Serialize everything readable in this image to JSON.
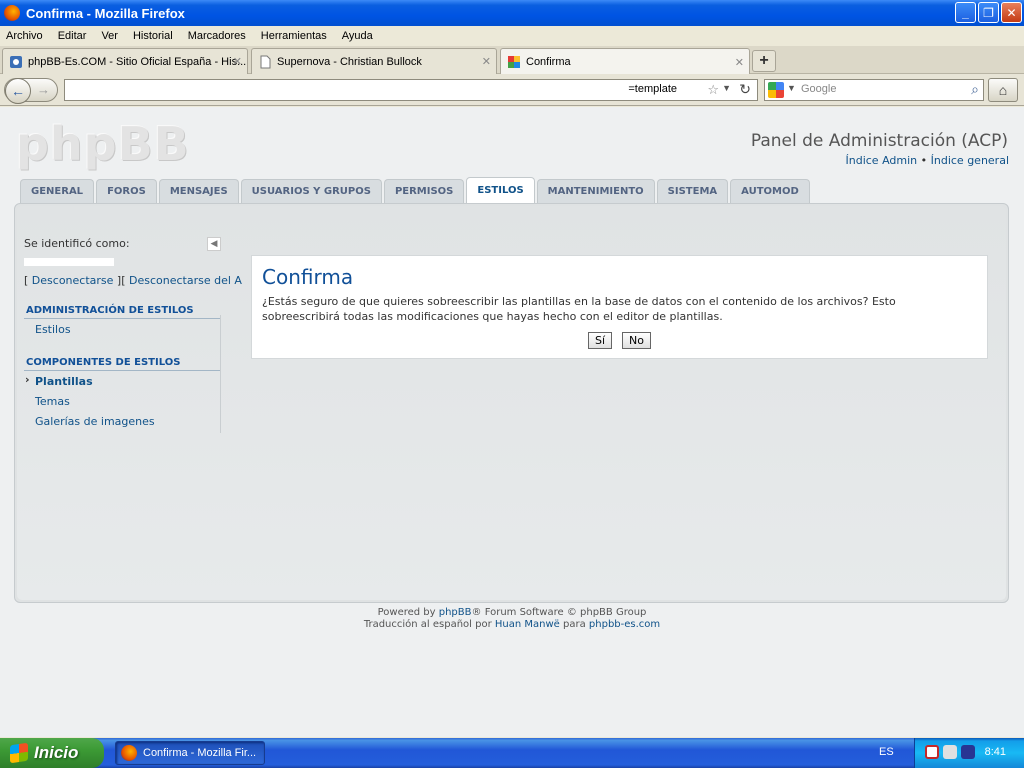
{
  "window": {
    "title": "Confirma - Mozilla Firefox"
  },
  "menu": [
    "Archivo",
    "Editar",
    "Ver",
    "Historial",
    "Marcadores",
    "Herramientas",
    "Ayuda"
  ],
  "tabs": [
    {
      "label": "phpBB-Es.COM - Sitio Oficial España - His..."
    },
    {
      "label": "Supernova - Christian Bullock"
    },
    {
      "label": "Confirma"
    }
  ],
  "nav": {
    "url": "=template",
    "search_placeholder": "Google"
  },
  "page": {
    "logo": "phpBB",
    "acp_title": "Panel de Administración (ACP)",
    "acp_links": {
      "admin": "Índice Admin",
      "sep": "•",
      "general": "Índice general"
    },
    "tabs": [
      "GENERAL",
      "FOROS",
      "MENSAJES",
      "USUARIOS Y GRUPOS",
      "PERMISOS",
      "ESTILOS",
      "MANTENIMIENTO",
      "SISTEMA",
      "AUTOMOD"
    ],
    "active_tab": "ESTILOS",
    "sidebar": {
      "identified": "Se identificó como:",
      "logout_1": "Desconectarse",
      "logout_2": "Desconectarse del A",
      "bracket_open": "[",
      "bracket_mid": "][",
      "sections": [
        {
          "heading": "ADMINISTRACIÓN DE ESTILOS",
          "items": [
            "Estilos"
          ]
        },
        {
          "heading": "COMPONENTES DE ESTILOS",
          "items": [
            "Plantillas",
            "Temas",
            "Galerías de imagenes"
          ]
        }
      ]
    },
    "confirm": {
      "title": "Confirma",
      "message": "¿Estás seguro de que quieres sobreescribir las plantillas en la base de datos con el contenido de los archivos? Esto sobreescribirá todas las modificaciones que hayas hecho con el editor de plantillas.",
      "yes": "Sí",
      "no": "No"
    },
    "footer": {
      "powered_by": "Powered by",
      "phpbb": "phpBB",
      "rest1": "® Forum Software © phpBB Group",
      "traduccion": "Traducción al español por",
      "translator": "Huan Manwë",
      "para": "para",
      "site": "phpbb-es.com"
    }
  },
  "taskbar": {
    "start": "Inicio",
    "item": "Confirma - Mozilla Fir...",
    "lang": "ES",
    "time": "8:41"
  }
}
